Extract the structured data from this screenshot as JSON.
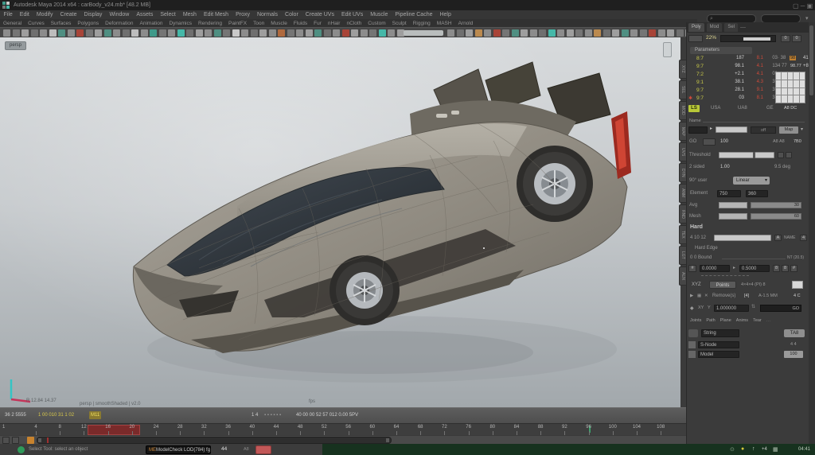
{
  "window": {
    "title": "Autodesk Maya 2014 x64 : carBody_v24.mb* [48.2 MB]",
    "controls": "▢ ─ ▣"
  },
  "menu_row1": [
    "File",
    "Edit",
    "Modify",
    "Create",
    "Display",
    "Window",
    "Assets",
    "Select",
    "Mesh",
    "Edit Mesh",
    "Proxy",
    "Normals",
    "Color",
    "Create UVs",
    "Edit UVs",
    "Muscle",
    "Pipeline Cache",
    "Help"
  ],
  "menu_row2": [
    "General",
    "Curves",
    "Surfaces",
    "Polygons",
    "Deformation",
    "Animation",
    "Dynamics",
    "Rendering",
    "PaintFX",
    "Toon",
    "Muscle",
    "Fluids",
    "Fur",
    "nHair",
    "nCloth",
    "Custom",
    "Sculpt",
    "Rigging",
    "MASH",
    "Arnold"
  ],
  "shelf": {
    "icons_a": [
      "#8c8c8c",
      "#757575",
      "#9e9e9e",
      "#6f6f6f",
      "#8c8c8c",
      "#bdbdbd",
      "#4f8f82",
      "#8c8c8c",
      "#a84438",
      "#757575",
      "#9e9e9e",
      "#4f8f82",
      "#8c8c8c",
      "#6f6f6f",
      "#bdbdbd",
      "#8c8c8c",
      "#3f9a8a",
      "#757575",
      "#8c8c8c",
      "#45b8a8",
      "#6f6f6f",
      "#9e9e9e",
      "#8c8c8c",
      "#4f8f82",
      "#757575",
      "#c9c9c9",
      "#8c8c8c",
      "#6f6f6f",
      "#9e9e9e",
      "#8c8c8c",
      "#b06a3e",
      "#757575",
      "#8c8c8c",
      "#9e9e9e",
      "#4f8f82",
      "#6f6f6f",
      "#8c8c8c",
      "#a84438",
      "#9e9e9e",
      "#8c8c8c",
      "#757575",
      "#45b8a8",
      "#8c8c8c",
      "#9e9e9e"
    ],
    "icons_b": [
      "#8c8c8c",
      "#6f6f6f",
      "#9e9e9e",
      "#bb8a4f",
      "#8c8c8c",
      "#a84438",
      "#757575",
      "#4f8f82",
      "#9e9e9e",
      "#8c8c8c",
      "#6f6f6f",
      "#45b8a8",
      "#8c8c8c",
      "#9e9e9e",
      "#757575",
      "#8c8c8c",
      "#bb8a4f",
      "#6f6f6f",
      "#9e9e9e",
      "#4f8f82",
      "#8c8c8c",
      "#757575",
      "#a84438",
      "#8c8c8c",
      "#9e9e9e",
      "#6f6f6f",
      "#8c8c8c",
      "#4f8f82",
      "#757575",
      "#9e9e9e",
      "#8c8c8c",
      "#6f6f6f",
      "#9e9e9e",
      "#8c8c8c",
      "#4f8f82",
      "#757575",
      "#8c8c8c",
      "#6f6f6f"
    ]
  },
  "viewport": {
    "pill": "persp",
    "info_left": "R 12.84 14.37",
    "info_center": "persp | smoothShaded | v2.0",
    "info_right": "fps"
  },
  "vertical_tabs": [
    "XYZ",
    "SEL",
    "MOD",
    "MAP",
    "UVS",
    "DYN",
    "ANM",
    "RND",
    "TEX",
    "LGT",
    "AUX"
  ],
  "right_panel": {
    "tabs": [
      "Poly",
      "Mod",
      "Sel"
    ],
    "tabs_more": "—",
    "progress": {
      "label": "22%",
      "btn1": "0",
      "btn2": "0"
    },
    "section_header": "Parameters",
    "attr_rows": [
      {
        "flag": "",
        "label": "8:7",
        "v1": "187",
        "v2": "8.1",
        "v3": "03",
        "e1": "· 38",
        "e2": "98",
        "e3": "41"
      },
      {
        "flag": "",
        "label": "9:7",
        "v1": "98.1",
        "v2": "4.1",
        "v3": "13",
        "e1": "4 77",
        "e2": "98.77",
        "e3": "+8"
      },
      {
        "flag": "",
        "label": "7:2",
        "v1": "+2.1",
        "v2": "4.1",
        "v3": "02",
        "e1": "",
        "e2": "",
        "e3": ""
      },
      {
        "flag": "",
        "label": "9:1",
        "v1": "38.1",
        "v2": "4.3",
        "v3": "38",
        "e1": "",
        "e2": "",
        "e3": ""
      },
      {
        "flag": "",
        "label": "9:7",
        "v1": "28.1",
        "v2": "9.1",
        "v3": "38",
        "e1": "",
        "e2": "",
        "e3": ""
      },
      {
        "flag": "✱",
        "label": "9:7",
        "v1": "03",
        "v2": "8.1",
        "v3": "38",
        "e1": "",
        "e2": "",
        "e3": ""
      }
    ],
    "ls_row": {
      "key": "LS",
      "i1": "USA",
      "i2": "UA8",
      "i3": "GE",
      "right": "A8 DC"
    },
    "name_label": "Name",
    "slider_row": {
      "mid": "off",
      "button": "Map",
      "arrow": "▾"
    },
    "go_row": {
      "label": "GO",
      "value": "100",
      "r1": "A8 A8",
      "r2": "7B0"
    },
    "threshold_row": {
      "label": "Threshold"
    },
    "two_sided_row": {
      "label": "2 sided",
      "value": "1.00",
      "right": "9.5 deg"
    },
    "dropdown_row": {
      "label": "90° user",
      "value": "Linear",
      "arrow": "▾"
    },
    "fields_row": {
      "label": "Element",
      "f1": "750",
      "f2": "360"
    },
    "avg_row": {
      "label": "Avg",
      "value": "30"
    },
    "mesh_row": {
      "label": "Mesh",
      "value": "60"
    },
    "hard": {
      "header": "Hard",
      "slider_label": "4 10 12",
      "btn1": "A",
      "mid": "NAME",
      "btn2": "4",
      "edge_text": "Hard Edge",
      "bound_label": "0 0 Bound",
      "bound_right": "NT (20.5)",
      "f1": "0.0000",
      "f2": "0.5000",
      "m1": "8",
      "m2": "8",
      "m3": "#"
    },
    "xyz_row": {
      "label": "XYZ",
      "button": "Points",
      "right": "4×4×4 (PI) 8"
    },
    "remove_row": {
      "i1": "▶",
      "i2": "▦",
      "i3": "✕",
      "label": "Remove(s)",
      "mid": "[4]",
      "right": "A-1.5 MM",
      "end": "4 C"
    },
    "lock_row": {
      "i1": "◆",
      "i2": "XY",
      "i3": "Y",
      "value": "1.000000",
      "go": "GO"
    },
    "bottom_tabs": [
      "Joints",
      "Path",
      "Plane",
      "Anims",
      "Tear"
    ],
    "bottom_tabs_more": "…",
    "string_row": {
      "value": "String",
      "button": "TA8"
    },
    "node_rows": [
      {
        "value": "S-Node",
        "right": "4 4"
      },
      {
        "value": "Model",
        "right": "100"
      }
    ]
  },
  "playbar": {
    "left1": "36 2 5555",
    "left2": "1 00 010 31 1 02",
    "chip": "M11",
    "right1": "1 4",
    "dots": "▪ ▪ ▪ ▪ ▪ ▪",
    "right2": "40 00 00 52 57 012 0.00 5PV"
  },
  "timeline": {
    "first": "1",
    "ticks": [
      "4",
      "8",
      "12",
      "16",
      "20",
      "24",
      "28",
      "32",
      "36",
      "40",
      "44",
      "48",
      "52",
      "56",
      "60",
      "64",
      "68",
      "72",
      "76",
      "80",
      "84",
      "88",
      "92",
      "96",
      "100",
      "104",
      "108"
    ]
  },
  "status": {
    "tool_text": "Select Tool: select an object",
    "cmd_prefix": "ME",
    "cmd": "ModelCheck LOD(784) fg",
    "num": "44",
    "mini": "A8",
    "clock": "04:41",
    "tray": {
      "g1": "⊙",
      "g2": "●",
      "g3": "↑",
      "g4": "+4",
      "g5": "▦"
    }
  },
  "colors": {
    "taillight": "#cf4534",
    "chip_yellow": "#d8c84a",
    "range_orange": "#c8832e",
    "status_green_dot": "#2f9a5a"
  }
}
